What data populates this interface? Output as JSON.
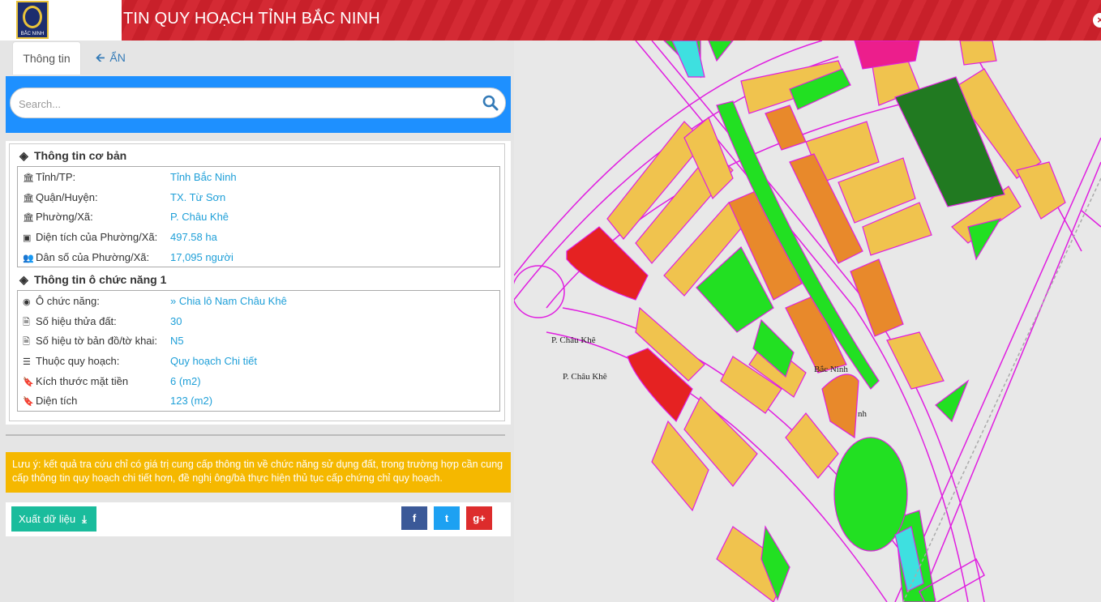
{
  "header": {
    "title": "TIN QUY HOẠCH TỈNH BẮC NINH",
    "logo_text": "BẮC NINH",
    "close_icon": "close-icon"
  },
  "tabs": {
    "info_label": "Thông tin",
    "hide_label": "ẨN"
  },
  "search": {
    "placeholder": "Search..."
  },
  "basic_info": {
    "title": "Thông tin cơ bản",
    "rows": [
      {
        "key": "Tỉnh/TP:",
        "value": "Tỉnh Bắc Ninh",
        "icon": "bank-icon"
      },
      {
        "key": "Quận/Huyện:",
        "value": "TX. Từ Sơn",
        "icon": "bank-icon"
      },
      {
        "key": "Phường/Xã:",
        "value": "P. Châu Khê",
        "icon": "bank-icon"
      },
      {
        "key": "Diện tích của Phường/Xã:",
        "value": "497.58 ha",
        "icon": "area-icon"
      },
      {
        "key": "Dân số của Phường/Xã:",
        "value": "17,095 người",
        "icon": "users-icon"
      }
    ]
  },
  "plot_info": {
    "title": "Thông tin ô chức năng 1",
    "rows": [
      {
        "key": "Ô chức năng:",
        "value": "» Chia lô Nam Châu Khê",
        "icon": "globe-icon"
      },
      {
        "key": "Số hiệu thửa đất:",
        "value": "30",
        "icon": "file-icon"
      },
      {
        "key": "Số hiệu tờ bản đồ/tờ khai:",
        "value": "N5",
        "icon": "file-icon"
      },
      {
        "key": "Thuộc quy hoạch:",
        "value": "Quy hoạch Chi tiết",
        "icon": "list-icon"
      },
      {
        "key": "Kích thước mặt tiền",
        "value": "6 (m2)",
        "icon": "bookmark-icon"
      },
      {
        "key": "Diện tích",
        "value": "123 (m2)",
        "icon": "bookmark-icon"
      }
    ]
  },
  "note": "Lưu ý: kết quả tra cứu chỉ có giá trị cung cấp thông tin về chức năng sử dụng đất, trong trường hợp cần cung cấp thông tin quy hoạch chi tiết hơn, đề nghị ông/bà thực hiện thủ tục cấp chứng chỉ quy hoạch.",
  "actions": {
    "export_label": "Xuất dữ liệu",
    "facebook": "f",
    "twitter": "t",
    "google": "g+"
  },
  "map": {
    "labels": [
      "P. Châu Khê",
      "P. Châu Khê",
      "Bắc Ninh",
      "nh"
    ],
    "colors": {
      "road": "#e01ee0",
      "lot": "#f0c34e",
      "orange_lot": "#e8892b",
      "park": "#22e022",
      "forest": "#217a21",
      "red": "#e52222",
      "pink": "#ec1e8c",
      "water": "#3ee0e0"
    }
  }
}
